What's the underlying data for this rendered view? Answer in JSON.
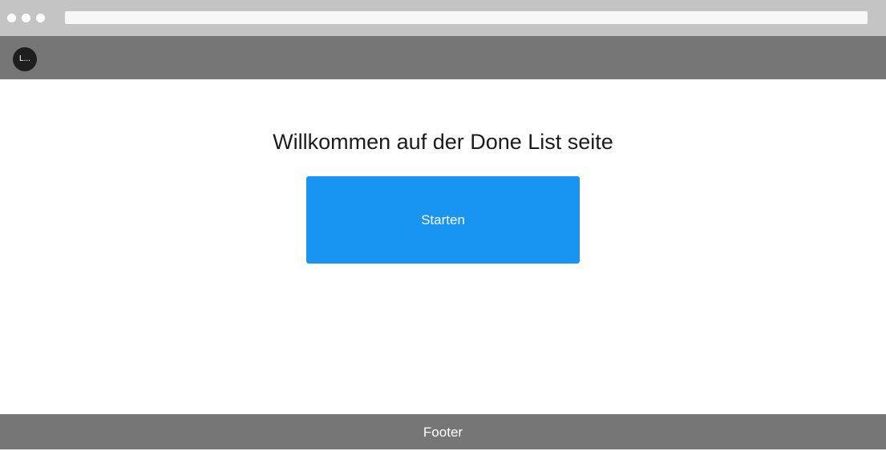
{
  "header": {
    "avatar_text": "L..."
  },
  "main": {
    "title": "Willkommen auf der Done List seite",
    "start_button_label": "Starten"
  },
  "footer": {
    "text": "Footer"
  },
  "colors": {
    "chrome": "#c4c4c4",
    "header": "#767676",
    "footer": "#767676",
    "button": "#1795f0",
    "avatar": "#1e1e1e"
  }
}
